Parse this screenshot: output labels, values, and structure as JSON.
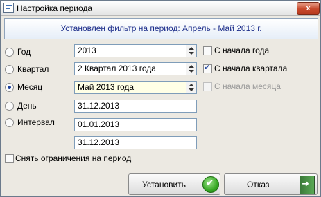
{
  "window": {
    "title": "Настройка периода",
    "close_label": "x"
  },
  "banner": {
    "text": "Установлен фильтр на период: Апрель - Май 2013 г."
  },
  "options": {
    "year": {
      "label": "Год",
      "value": "2013",
      "selected": false
    },
    "quarter": {
      "label": "Квартал",
      "value": "2 Квартал 2013 года",
      "selected": false
    },
    "month": {
      "label": "Месяц",
      "value": "Май 2013 года",
      "selected": true
    },
    "day": {
      "label": "День",
      "value": "31.12.2013",
      "selected": false
    },
    "interval": {
      "label": "Интервал",
      "from": "01.01.2013",
      "to": "31.12.2013",
      "selected": false
    }
  },
  "checkboxes": {
    "from_year_start": {
      "label": "С начала года",
      "checked": false,
      "enabled": true
    },
    "from_quarter_start": {
      "label": "С начала квартала",
      "checked": true,
      "enabled": true
    },
    "from_month_start": {
      "label": "С начала месяца",
      "checked": false,
      "enabled": false
    },
    "remove_limit": {
      "label": "Снять ограничения на период",
      "checked": false,
      "enabled": true
    }
  },
  "buttons": {
    "set_label": "Установить",
    "cancel_label": "Отказ"
  },
  "icons": {
    "window": "document-icon",
    "set": "checkmark-circle-icon",
    "cancel": "exit-door-icon"
  }
}
